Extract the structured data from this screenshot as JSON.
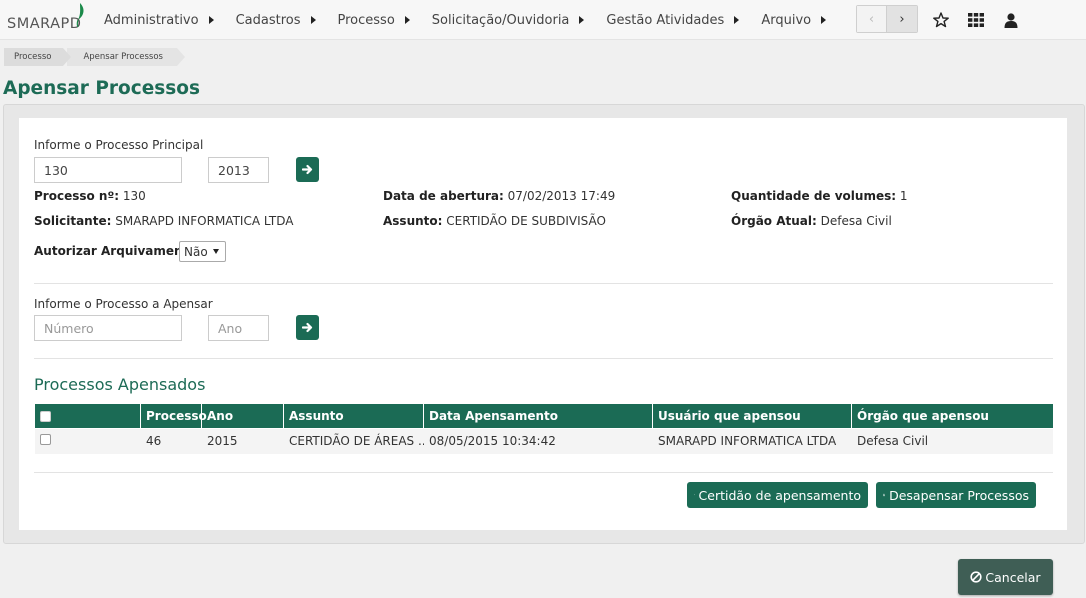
{
  "app": {
    "logo_text": "SMARAPD"
  },
  "nav": {
    "items": [
      {
        "label": "Administrativo"
      },
      {
        "label": "Cadastros"
      },
      {
        "label": "Processo"
      },
      {
        "label": "Solicitação/Ouvidoria"
      },
      {
        "label": "Gestão Atividades"
      },
      {
        "label": "Arquivo"
      }
    ],
    "prev_glyph": "‹",
    "next_glyph": "›"
  },
  "breadcrumb": [
    "Processo",
    "Apensar Processos"
  ],
  "page_title": "Apensar Processos",
  "principal": {
    "label": "Informe o Processo Principal",
    "numero_value": "130",
    "ano_value": "2013"
  },
  "details": {
    "processo_label": "Processo nº:",
    "processo_value": "130",
    "abertura_label": "Data de abertura:",
    "abertura_value": "07/02/2013 17:49",
    "volumes_label": "Quantidade de volumes:",
    "volumes_value": "1",
    "solicitante_label": "Solicitante:",
    "solicitante_value": "SMARAPD INFORMATICA LTDA",
    "assunto_label": "Assunto:",
    "assunto_value": "CERTIDÃO DE SUBDIVISÃO",
    "orgao_label": "Órgão Atual:",
    "orgao_value": "Defesa Civil",
    "arquivamento_label": "Autorizar Arquivamento:",
    "arquivamento_value": "Não"
  },
  "apensar": {
    "label": "Informe o Processo a Apensar",
    "numero_placeholder": "Número",
    "ano_placeholder": "Ano"
  },
  "apensados": {
    "title": "Processos Apensados",
    "columns": [
      "Processo",
      "Ano",
      "Assunto",
      "Data Apensamento",
      "Usuário que apensou",
      "Órgão que apensou"
    ],
    "rows": [
      {
        "processo": "46",
        "ano": "2015",
        "assunto": "CERTIDÃO DE ÁREAS ...",
        "data": "08/05/2015 10:34:42",
        "usuario": "SMARAPD INFORMATICA LTDA",
        "orgao": "Defesa Civil"
      }
    ]
  },
  "actions": {
    "certidao_label": "Certidão de apensamento",
    "desapensar_label": "Desapensar Processos",
    "cancel_label": "Cancelar"
  },
  "colors": {
    "brand": "#1b6b55",
    "title": "#1d6b56",
    "cancel": "#3f5e55"
  }
}
